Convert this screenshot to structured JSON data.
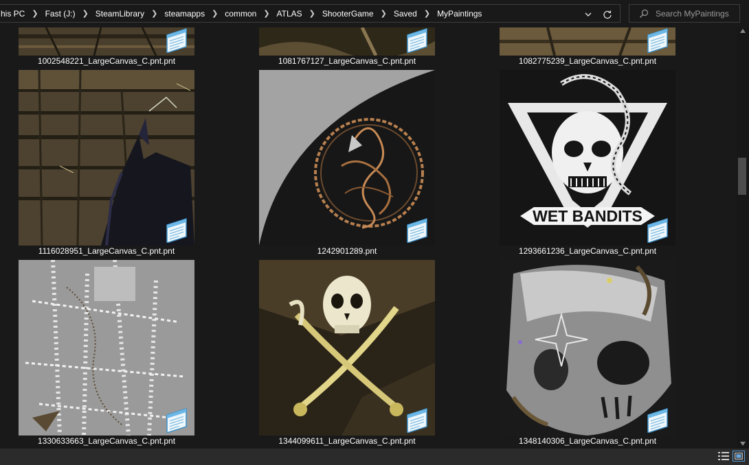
{
  "breadcrumb": [
    "his PC",
    "Fast (J:)",
    "SteamLibrary",
    "steamapps",
    "common",
    "ATLAS",
    "ShooterGame",
    "Saved",
    "MyPaintings"
  ],
  "search": {
    "placeholder": "Search MyPaintings"
  },
  "files": [
    "1002548221_LargeCanvas_C.pnt.pnt",
    "1081767127_LargeCanvas_C.pnt.pnt",
    "1082775239_LargeCanvas_C.pnt.pnt",
    "1116028951_LargeCanvas_C.pnt.pnt",
    "1242901289.pnt",
    "1293661236_LargeCanvas_C.pnt.pnt",
    "1330633663_LargeCanvas_C.pnt.pnt",
    "1344099611_LargeCanvas_C.pnt.pnt",
    "1348140306_LargeCanvas_C.pnt.pnt"
  ],
  "paintings": {
    "wet_bandits_banner": "WET BANDITS"
  },
  "icons": {
    "address_dropdown": "chevron-down-icon",
    "refresh": "refresh-icon",
    "search": "search-icon",
    "file_badge": "notepad-file-icon",
    "view_details": "details-view-icon",
    "view_thumbnails": "large-icons-view-icon"
  },
  "colors": {
    "background": "#191919",
    "text": "#ffffff",
    "border": "#3d3d3d",
    "accent": "#5a9bd5"
  }
}
